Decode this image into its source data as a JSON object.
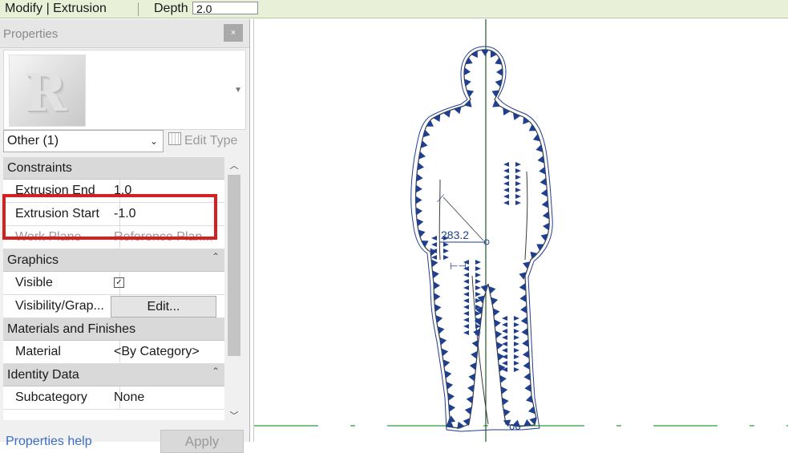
{
  "options_bar": {
    "title": "Modify | Extrusion",
    "depth_label": "Depth",
    "depth_value": "2.0"
  },
  "properties": {
    "title": "Properties",
    "close_label": "×",
    "filter_value": "Other (1)",
    "edit_type_label": "Edit Type",
    "sections": {
      "constraints": "Constraints",
      "graphics": "Graphics",
      "materials": "Materials and Finishes",
      "identity": "Identity Data"
    },
    "rows": {
      "extrusion_end": {
        "label": "Extrusion End",
        "value": "1.0"
      },
      "extrusion_start": {
        "label": "Extrusion Start",
        "value": "-1.0"
      },
      "work_plane": {
        "label": "Work Plane",
        "value": "Reference Plan..."
      },
      "visible": {
        "label": "Visible",
        "checked": true
      },
      "visibility_graphics": {
        "label": "Visibility/Grap...",
        "button": "Edit..."
      },
      "material": {
        "label": "Material",
        "value": "<By Category>"
      },
      "subcategory": {
        "label": "Subcategory",
        "value": "None"
      }
    },
    "help_link": "Properties help",
    "apply_label": "Apply"
  },
  "canvas": {
    "dimension_label": "283.2",
    "colors": {
      "sketch": "#1f3f8f",
      "outline": "#3a3a3a",
      "ref_plane": "#2e9b3c",
      "highlight": "#d42020"
    }
  }
}
